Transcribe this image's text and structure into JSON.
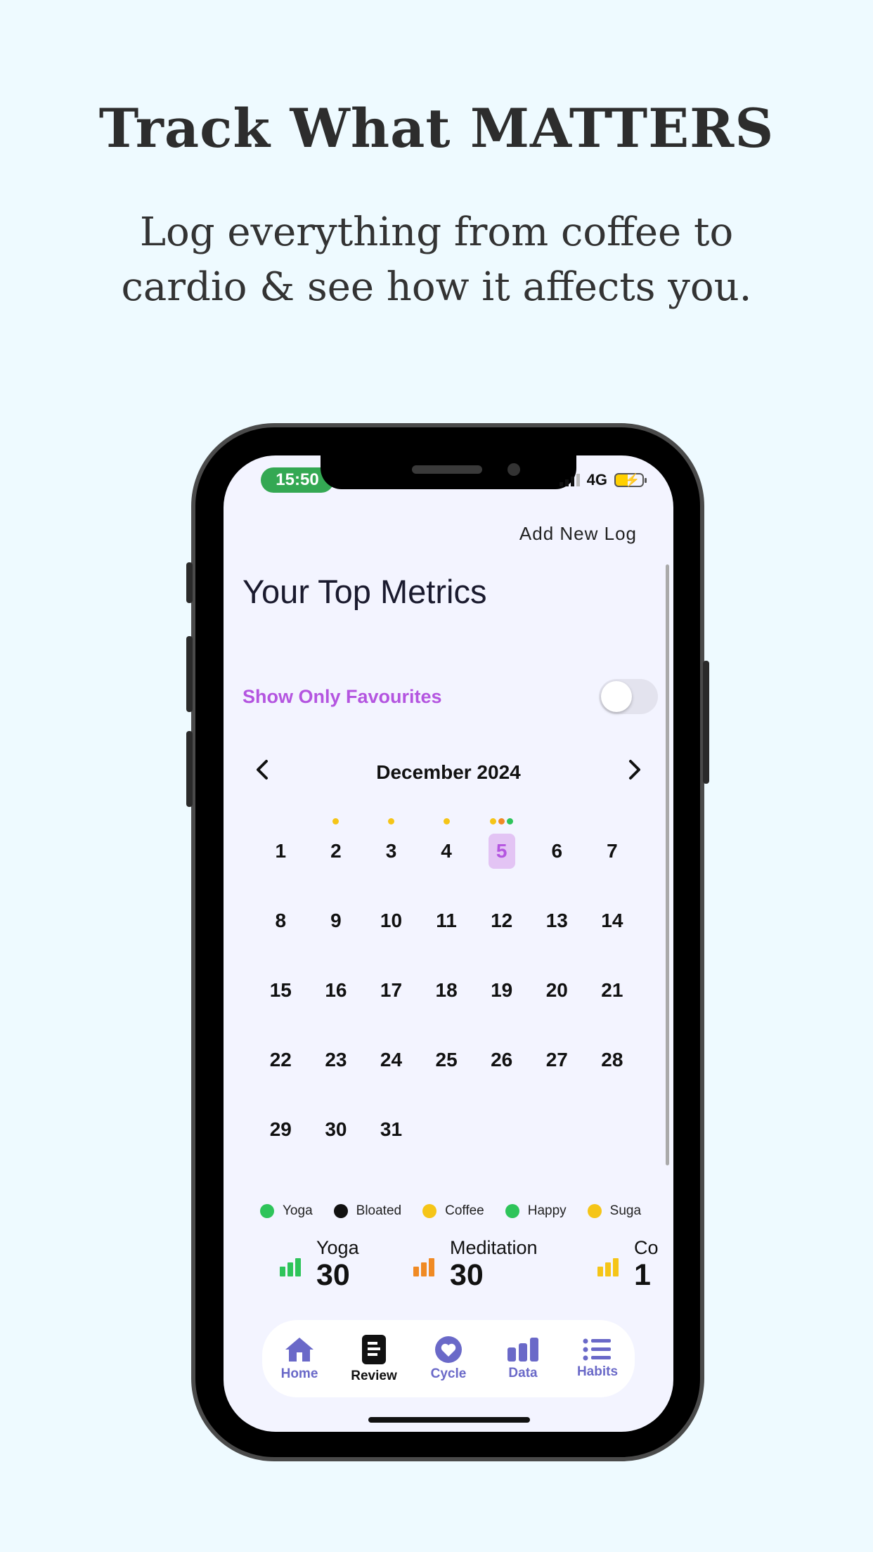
{
  "hero": {
    "title": "Track What MATTERS",
    "subtitle_line1": "Log everything from coffee to",
    "subtitle_line2": "cardio & see how it affects you."
  },
  "status_bar": {
    "time": "15:50",
    "network": "4G"
  },
  "header": {
    "add_log": "Add New Log"
  },
  "page_title": "Your Top Metrics",
  "favourites": {
    "label": "Show Only Favourites",
    "enabled": false
  },
  "calendar": {
    "month": "December 2024",
    "prev_icon": "chevron-left-icon",
    "next_icon": "chevron-right-icon",
    "selected_day": 5,
    "days": [
      "1",
      "2",
      "3",
      "4",
      "5",
      "6",
      "7",
      "8",
      "9",
      "10",
      "11",
      "12",
      "13",
      "14",
      "15",
      "16",
      "17",
      "18",
      "19",
      "20",
      "21",
      "22",
      "23",
      "24",
      "25",
      "26",
      "27",
      "28",
      "29",
      "30",
      "31"
    ],
    "day_dots": {
      "2": [
        "#f5c518"
      ],
      "3": [
        "#f5c518"
      ],
      "4": [
        "#f5c518"
      ],
      "5": [
        "#f5c518",
        "#f08a24",
        "#2ec45a"
      ]
    }
  },
  "legend": [
    {
      "label": "Yoga",
      "color": "#2ec45a"
    },
    {
      "label": "Bloated",
      "color": "#111111"
    },
    {
      "label": "Coffee",
      "color": "#f5c518"
    },
    {
      "label": "Happy",
      "color": "#2ec45a"
    },
    {
      "label": "Suga",
      "color": "#f5c518"
    }
  ],
  "metrics": [
    {
      "name": "Yoga",
      "value": "30",
      "color": "#2ec45a",
      "icon": "bar-chart-icon"
    },
    {
      "name": "Meditation",
      "value": "30",
      "color": "#f08a24",
      "icon": "bar-chart-icon"
    },
    {
      "name": "Co",
      "value": "1",
      "color": "#f5c518",
      "icon": "bar-chart-icon"
    }
  ],
  "tabs": [
    {
      "label": "Home",
      "icon": "home-icon"
    },
    {
      "label": "Review",
      "icon": "review-icon",
      "active": true
    },
    {
      "label": "Cycle",
      "icon": "heart-icon"
    },
    {
      "label": "Data",
      "icon": "bar-chart-icon"
    },
    {
      "label": "Habits",
      "icon": "list-icon"
    }
  ],
  "colors": {
    "accent": "#b455e0",
    "tab": "#6a69c8",
    "background": "#eefaff",
    "screen": "#f3f4ff"
  }
}
